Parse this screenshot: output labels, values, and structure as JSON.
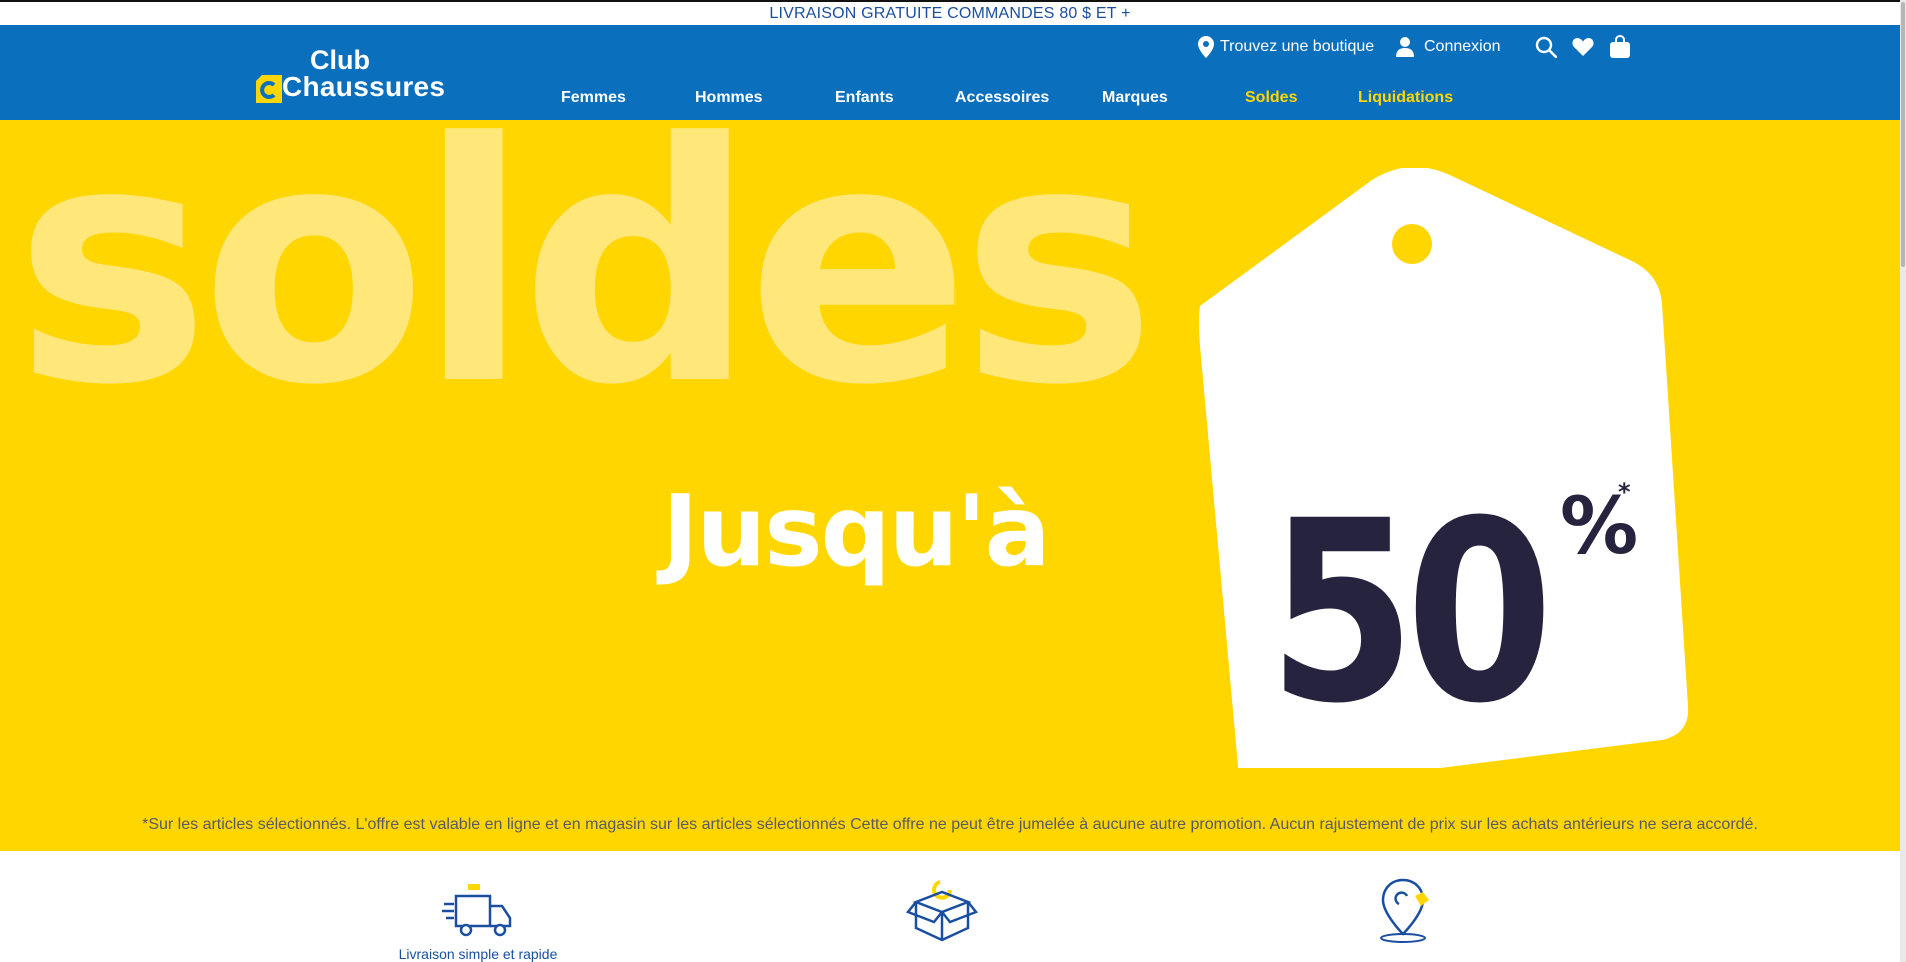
{
  "announcement": "LIVRAISON GRATUITE COMMANDES 80 $ ET +",
  "brand": {
    "line1": "Club",
    "line2": "Chaussures",
    "accent": "#ffd600",
    "blue": "#0a6fbd"
  },
  "header": {
    "store_finder": "Trouvez une boutique",
    "login": "Connexion",
    "icons": [
      "location-pin-icon",
      "user-icon",
      "search-icon",
      "heart-icon",
      "shopping-bag-icon"
    ]
  },
  "nav": [
    {
      "label": "Femmes"
    },
    {
      "label": "Hommes"
    },
    {
      "label": "Enfants"
    },
    {
      "label": "Accessoires"
    },
    {
      "label": "Marques"
    },
    {
      "label": "Soldes",
      "highlight": true
    },
    {
      "label": "Liquidations",
      "highlight": true
    }
  ],
  "hero": {
    "word": "soldes",
    "upto": "Jusqu'à",
    "percent": "50",
    "percent_sign": "%",
    "asterisk": "*",
    "disclaimer": "*Sur les articles sélectionnés. L'offre est valable en ligne et en magasin sur les articles sélectionnés  Cette offre ne peut être jumelée à aucune autre promotion. Aucun rajustement de prix sur les achats antérieurs ne sera accordé."
  },
  "features": [
    {
      "icon": "delivery-truck-icon",
      "label": "Livraison simple et rapide"
    },
    {
      "icon": "return-box-icon",
      "label": ""
    },
    {
      "icon": "store-location-icon",
      "label": ""
    }
  ]
}
